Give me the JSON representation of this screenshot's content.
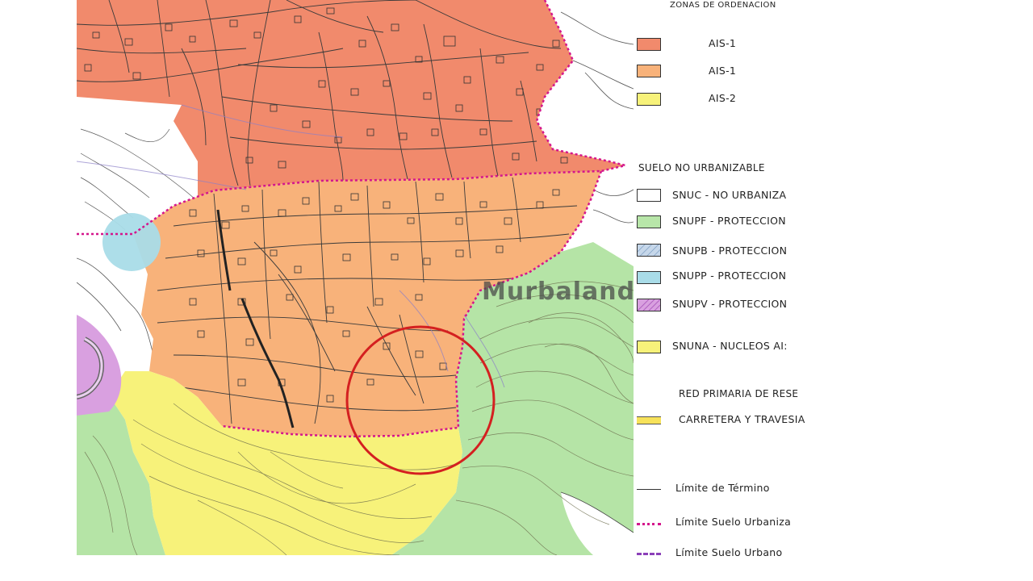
{
  "legend": {
    "zones_title": "ZONAS DE ORDENACION",
    "zones": [
      {
        "name": "zone-ais1-dark",
        "label": "AIS-1",
        "color": "#f18a6c"
      },
      {
        "name": "zone-ais1-light",
        "label": "AIS-1",
        "color": "#f8b27a"
      },
      {
        "name": "zone-ais2",
        "label": "AIS-2",
        "color": "#f7f27a"
      }
    ],
    "nonurban_title": "SUELO NO URBANIZABLE",
    "nonurban": [
      {
        "name": "snuc",
        "label": "SNUC - NO URBANIZA",
        "color": "#ffffff"
      },
      {
        "name": "snupf",
        "label": "SNUPF - PROTECCION",
        "color": "#b8e6a9"
      },
      {
        "name": "snupb",
        "label": "SNUPB - PROTECCION",
        "color": "#a8c4de"
      },
      {
        "name": "snupp",
        "label": "SNUPP - PROTECCION",
        "color": "#a9dce8"
      },
      {
        "name": "snupv",
        "label": "SNUPV - PROTECCION",
        "color": "#d9a0e0"
      },
      {
        "name": "snuna",
        "label": "SNUNA - NUCLEOS AI:",
        "color": "#f7f27a"
      }
    ],
    "network_title": "RED PRIMARIA DE RESE",
    "road_label": "CARRETERA Y TRAVESIA",
    "lines": [
      {
        "name": "limite-termino",
        "label": "Límite de Término"
      },
      {
        "name": "limite-suelo-urbanizable",
        "label": "Límite Suelo Urbaniza"
      },
      {
        "name": "limite-suelo-urbano",
        "label": "Límite Suelo Urbano"
      }
    ]
  },
  "watermark": "Murbalands ®",
  "map": {
    "colors": {
      "ais1_dark": "#f18a6c",
      "ais1_light": "#f8b27a",
      "ais2": "#f7f27a",
      "green": "#b5e4a6",
      "blue": "#a9dce8",
      "purple": "#d9a0e0",
      "boundary": "#d4168c",
      "highlight": "#d42020"
    }
  }
}
